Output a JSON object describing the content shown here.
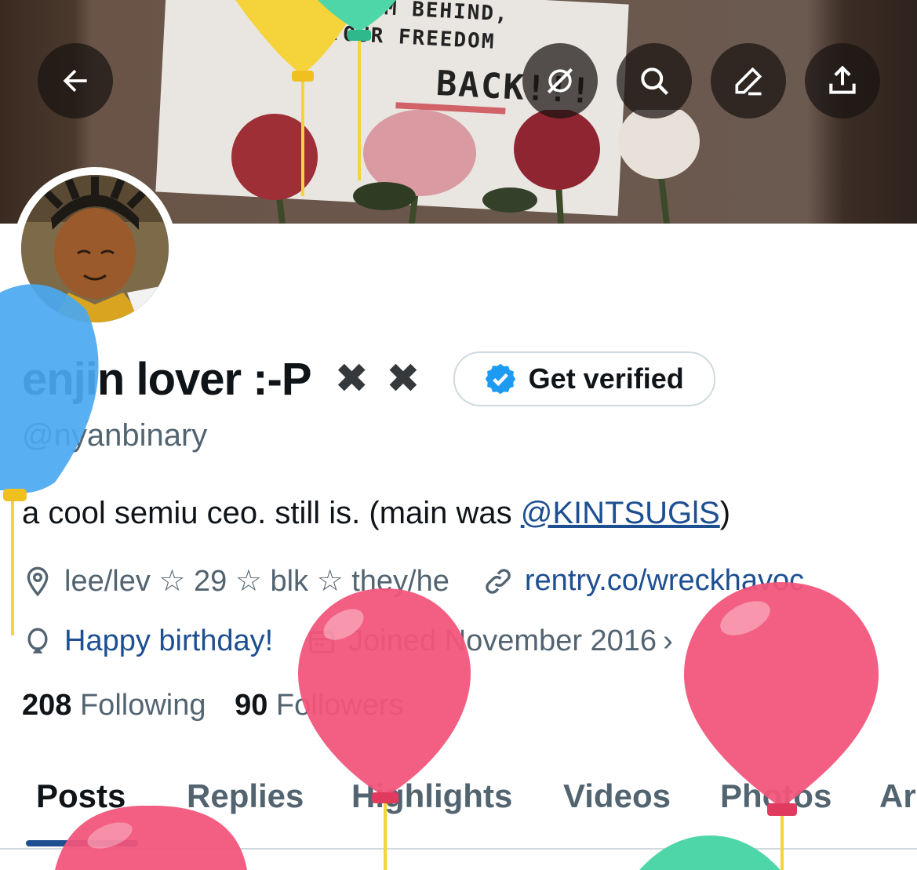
{
  "banner": {
    "poster_lines": [
      "LEAVE THEM BEHIND,",
      "GET YOUR FREEDOM",
      "BACK!!!"
    ]
  },
  "header_buttons": {
    "back": "back-arrow-icon",
    "grok": "grok-slash-icon",
    "search": "search-icon",
    "edit": "edit-pen-icon",
    "share": "share-icon"
  },
  "profile": {
    "display_name": "enjin lover :-P",
    "name_marks": [
      "✖",
      "✖"
    ],
    "get_verified_label": "Get verified",
    "handle": "@nyanbinary",
    "bio_prefix": "a cool semiu ceo. still is. (main was ",
    "bio_link": "@KINTSUGlS",
    "bio_suffix": ")",
    "location": "lee/lev ☆ 29 ☆ blk ☆ they/he",
    "website": "rentry.co/wreckhavoc",
    "birthday": "Happy birthday!",
    "joined": "Joined November 2016",
    "following_count": "208",
    "following_label": "Following",
    "followers_count": "90",
    "followers_label": "Followers"
  },
  "tabs": [
    "Posts",
    "Replies",
    "Highlights",
    "Videos",
    "Photos",
    "Ar"
  ],
  "active_tab": "Posts",
  "colors": {
    "link": "#1d4f91",
    "verified_badge": "#1d9bf0",
    "balloon_pink": "#f2557a",
    "balloon_blue": "#4aa8f0",
    "balloon_green": "#4fd6a8",
    "balloon_yellow": "#f5d33a"
  }
}
